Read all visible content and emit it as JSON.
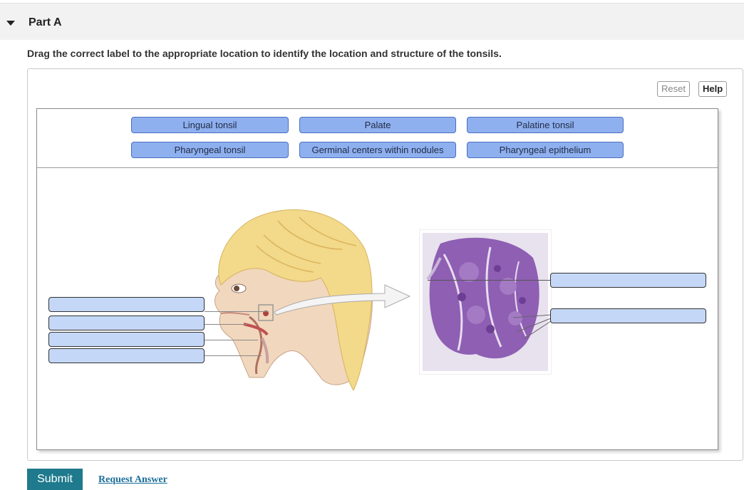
{
  "part": {
    "title": "Part A"
  },
  "instructions": "Drag the correct label to the appropriate location to identify the location and structure of the tonsils.",
  "toolbar": {
    "reset_label": "Reset",
    "help_label": "Help"
  },
  "label_bank": [
    "Lingual tonsil",
    "Palate",
    "Palatine tonsil",
    "Pharyngeal tonsil",
    "Germinal centers within nodules",
    "Pharyngeal epithelium"
  ],
  "footer": {
    "submit_label": "Submit",
    "request_label": "Request Answer"
  },
  "colors": {
    "chip_fill": "#8fb0ef",
    "target_fill": "#c4d7f7",
    "submit_bg": "#1e7a8c",
    "link": "#1a6e9a"
  },
  "icons": [
    "caret-down-icon",
    "arrow-icon"
  ]
}
